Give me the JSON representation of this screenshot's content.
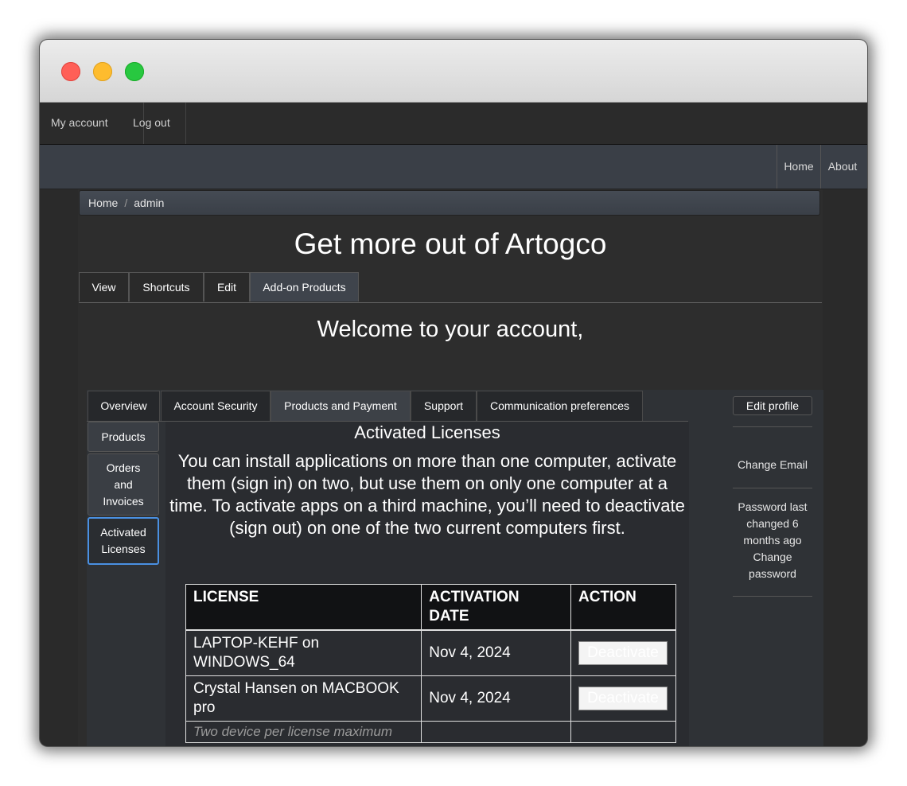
{
  "topbar": {
    "my_account": "My account",
    "log_out": "Log out"
  },
  "navbar": {
    "home": "Home",
    "about": "About"
  },
  "breadcrumb": {
    "home": "Home",
    "separator": "/",
    "current": "admin"
  },
  "page_title": "Get more out of Artogco",
  "tabs": [
    {
      "label": "View"
    },
    {
      "label": "Shortcuts"
    },
    {
      "label": "Edit"
    },
    {
      "label": "Add-on Products",
      "active": true
    }
  ],
  "welcome": "Welcome to your account,",
  "subtabs": [
    {
      "label": "Overview"
    },
    {
      "label": "Account Security"
    },
    {
      "label": "Products and Payment",
      "active": true
    },
    {
      "label": "Support"
    },
    {
      "label": "Communication preferences"
    }
  ],
  "side_menu": [
    {
      "label": "Products"
    },
    {
      "label": "Orders and Invoices"
    },
    {
      "label": "Activated Licenses",
      "active": true
    }
  ],
  "content": {
    "title": "Activated Licenses",
    "description": "You can install applications on more than one computer, activate them (sign in) on two, but use them on only one computer at a time. To activate apps on a third machine, you’ll need to deactivate (sign out) on one of the two current computers first."
  },
  "table": {
    "headers": [
      "LICENSE",
      "ACTIVATION DATE",
      "ACTION"
    ],
    "rows": [
      {
        "license": "LAPTOP-KEHF on WINDOWS_64",
        "date": "Nov 4, 2024",
        "action": "Deactivate"
      },
      {
        "license": "Crystal Hansen on MACBOOK pro",
        "date": "Nov 4, 2024",
        "action": "Deactivate"
      }
    ],
    "note": "Two device per license maximum"
  },
  "right_panel": {
    "edit_profile": "Edit profile",
    "change_email": "Change Email",
    "password_status": "Password last changed 6 months ago",
    "change_password": "Change password"
  },
  "colors": {
    "active_focus": "#4a90e2",
    "header_bg": "#111214",
    "navbar_bg": "#3a3f47"
  }
}
